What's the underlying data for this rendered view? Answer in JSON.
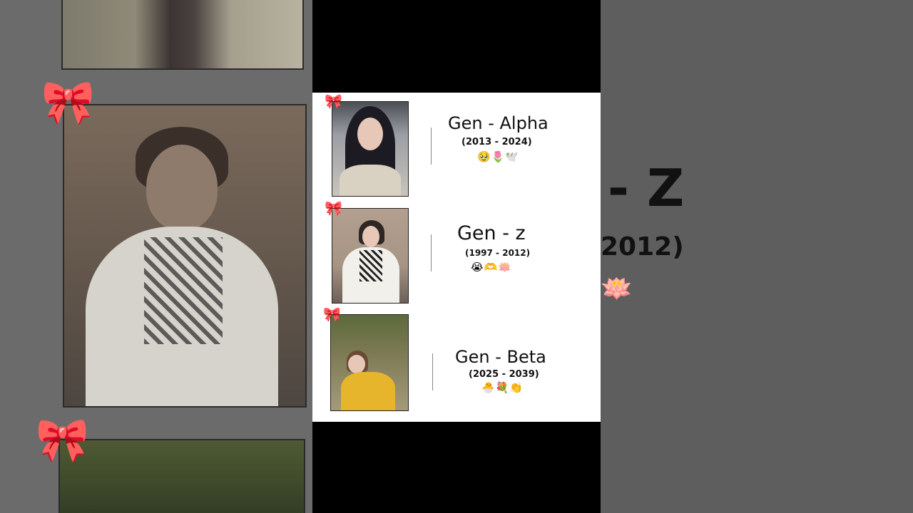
{
  "entries": [
    {
      "title": "Gen - Alpha",
      "years": "(2013 - 2024)",
      "emojis": "🥹🌷🕊️"
    },
    {
      "title": "Gen - z",
      "years": "(1997 - 2012)",
      "emojis": "😭🫶🪷"
    },
    {
      "title": "Gen - Beta",
      "years": "(2025 - 2039)",
      "emojis": "🐣💐👏"
    }
  ],
  "background": {
    "big_title": "- Z",
    "big_years": "2012)",
    "emoji": "🪷"
  },
  "colors": {
    "card": "#ffffff",
    "letterbox": "#000000",
    "side_background": "#5a5a5a",
    "bow": "#e47c9e"
  },
  "icons": [
    "bow-icon",
    "bow-icon",
    "bow-icon"
  ]
}
